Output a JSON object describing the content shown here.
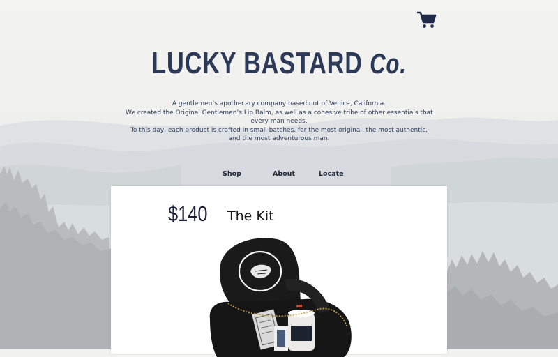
{
  "brand": {
    "name": "LUCKY BASTARD",
    "suffix": "Co."
  },
  "tagline": {
    "lines": [
      "A gentlemen’s apothecary company based out of Venice, California.",
      "We created the Original Gentlemen’s Lip Balm, as well as a cohesive tribe of other essentials that",
      "every man needs.",
      "To this day, each product is crafted in small batches, for the most original, the most authentic,",
      "and the most adventurous man."
    ]
  },
  "nav": {
    "items": [
      {
        "label": "Shop"
      },
      {
        "label": "About"
      },
      {
        "label": "Locate"
      }
    ]
  },
  "product": {
    "price": "$140",
    "name": "The Kit"
  },
  "colors": {
    "brand_navy": "#2c3a58",
    "cart_navy": "#1f2a48",
    "page_bg": "#f1f1ef",
    "card_bg": "#ffffff"
  },
  "icons": {
    "cart": "shopping-cart-icon"
  }
}
